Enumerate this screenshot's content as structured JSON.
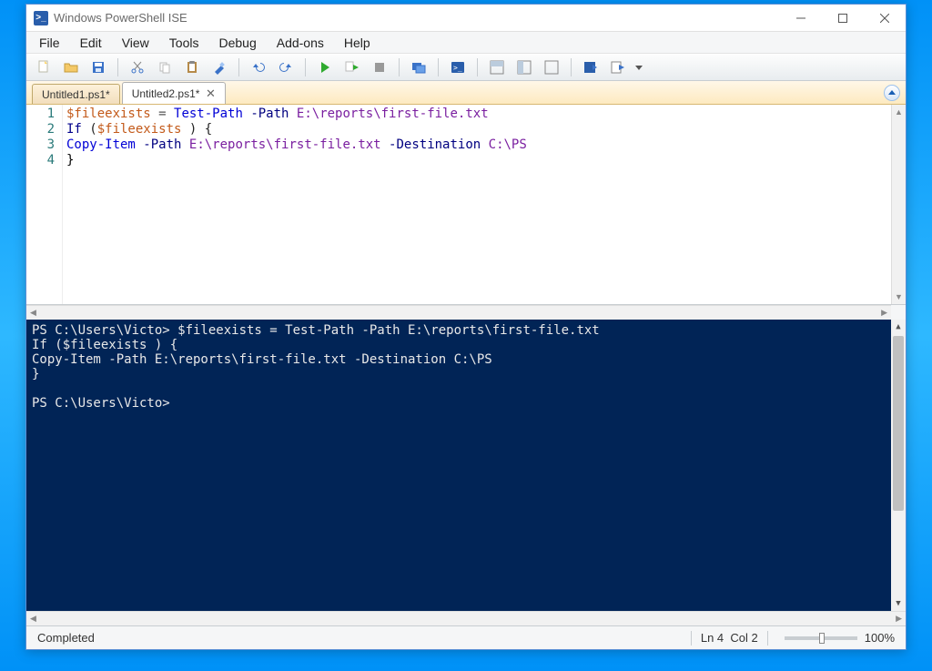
{
  "title": "Windows PowerShell ISE",
  "menu": [
    "File",
    "Edit",
    "View",
    "Tools",
    "Debug",
    "Add-ons",
    "Help"
  ],
  "toolbar_icons": [
    "new-file",
    "open-file",
    "save-file",
    "|",
    "cut",
    "copy",
    "paste",
    "clear",
    "|",
    "undo",
    "redo",
    "|",
    "run",
    "run-selection",
    "stop",
    "|",
    "remote",
    "|",
    "powershell",
    "|",
    "layout-a",
    "layout-b",
    "layout-c",
    "|",
    "show-script",
    "show-command",
    "more"
  ],
  "tabs": [
    {
      "label": "Untitled1.ps1*",
      "active": false
    },
    {
      "label": "Untitled2.ps1*",
      "active": true
    }
  ],
  "code_lines": [
    {
      "n": "1",
      "tokens": [
        [
          "var",
          "$fileexists"
        ],
        [
          "op",
          " = "
        ],
        [
          "cmd",
          "Test-Path"
        ],
        [
          "",
          "  "
        ],
        [
          "param",
          "-Path"
        ],
        [
          "",
          ""
        ],
        [
          "",
          ""
        ],
        [
          "",
          ""
        ],
        [
          "",
          ""
        ],
        [
          "",
          ""
        ],
        [
          "",
          ""
        ],
        [
          "",
          ""
        ],
        [
          "",
          ""
        ],
        [
          "",
          ""
        ],
        [
          "",
          ""
        ],
        [
          "",
          ""
        ],
        [
          "var",
          ""
        ],
        [
          "",
          ""
        ],
        [
          "",
          ""
        ],
        [
          "",
          ""
        ],
        [
          "",
          ""
        ],
        [
          "",
          ""
        ],
        [
          "",
          ""
        ],
        [
          "",
          ""
        ],
        [
          "",
          ""
        ],
        [
          "",
          ""
        ],
        [
          "",
          ""
        ],
        [
          "",
          ""
        ],
        [
          "",
          ""
        ],
        [
          "",
          ""
        ],
        [
          "",
          ""
        ],
        [
          "",
          ""
        ],
        [
          "",
          ""
        ],
        [
          "",
          ""
        ],
        [
          "",
          ""
        ],
        [
          "",
          ""
        ],
        [
          "",
          ""
        ],
        [
          "",
          ""
        ],
        [
          "",
          ""
        ],
        [
          "",
          ""
        ],
        [
          "",
          ""
        ],
        [
          "",
          ""
        ],
        [
          "",
          ""
        ],
        [
          "",
          ""
        ],
        [
          "",
          ""
        ],
        [
          "",
          ""
        ],
        [
          "",
          ""
        ],
        [
          "",
          ""
        ],
        [
          "",
          ""
        ],
        [
          "",
          ""
        ]
      ]
    }
  ],
  "code_html": {
    "l1": {
      "var": "$fileexists",
      "eq": " = ",
      "cmd": "Test-Path",
      "sp": " ",
      "par": "-Path",
      "sp2": " ",
      "path": "E:\\reports\\first-file.txt"
    },
    "l2": {
      "kw": "If",
      "sp": " (",
      "var": "$fileexists",
      "sp2": " ) {"
    },
    "l3": {
      "cmd": "Copy-Item",
      "sp": " ",
      "par": "-Path",
      "sp2": " ",
      "path": "E:\\reports\\first-file.txt",
      "sp3": " ",
      "par2": "-Destination",
      "sp4": " ",
      "path2": "C:\\PS"
    },
    "l4": {
      "brace": "}"
    }
  },
  "line_numbers": [
    "1",
    "2",
    "3",
    "4"
  ],
  "console_text": "PS C:\\Users\\Victo> $fileexists = Test-Path -Path E:\\reports\\first-file.txt\nIf ($fileexists ) {\nCopy-Item -Path E:\\reports\\first-file.txt -Destination C:\\PS\n}\n\nPS C:\\Users\\Victo>",
  "status": {
    "left": "Completed",
    "ln": "Ln 4",
    "col": "Col 2",
    "zoom": "100%"
  },
  "icons": {
    "powershell_glyph": ">_"
  }
}
